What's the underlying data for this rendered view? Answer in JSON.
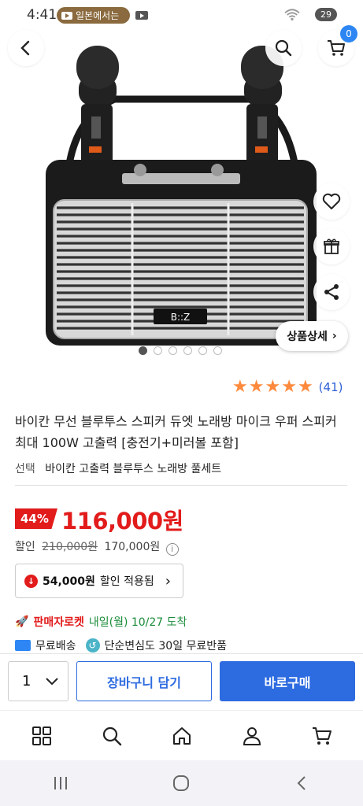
{
  "status_bar": {
    "time": "4:41",
    "notification_label": "일본에서는",
    "battery": "29"
  },
  "header": {
    "cart_count": "0"
  },
  "gallery": {
    "detail_button_label": "상품상세",
    "total_images": 6,
    "active_index": 0,
    "speaker_brand": "B::Z"
  },
  "product": {
    "rating_stars": 5,
    "rating_count": "(41)",
    "title": "바이칸 무선 블루투스 스피커 듀엣 노래방 마이크 우퍼 스피커 최대 100W 고출력 [충전기+미러볼 포함]",
    "option_label": "선택",
    "option_value": "바이칸 고출력 블루투스 노래방 풀세트",
    "discount_rate": "44%",
    "price": "116,000원",
    "sale_label": "할인",
    "original_price": "210,000원",
    "sale_price": "170,000원",
    "coupon_amount": "54,000원",
    "coupon_text": "할인 적용됨",
    "rocket_label": "판매자로켓",
    "delivery_date": "내일(월) 10/27 도착",
    "free_shipping": "무료배송",
    "return_policy": "단순변심도 30일 무료반품"
  },
  "action_bar": {
    "quantity": "1",
    "add_to_cart": "장바구니 담기",
    "buy_now": "바로구매"
  },
  "colors": {
    "accent_blue": "#2d6be0",
    "price_red": "#e21b1b",
    "star_orange": "#ff8a3d",
    "delivery_green": "#1a8c3a"
  }
}
